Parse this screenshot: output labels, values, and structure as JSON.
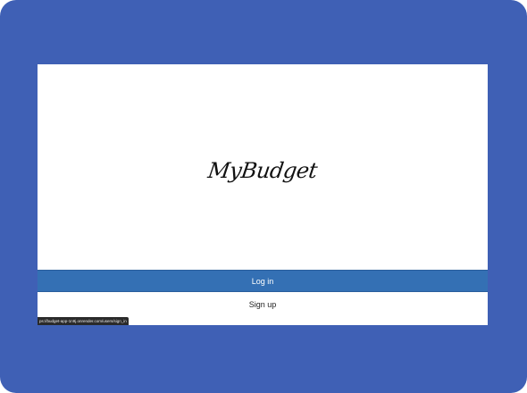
{
  "colors": {
    "frame": "#3f60b5",
    "login_button": "#3470b4",
    "screen_background": "#ffffff"
  },
  "app": {
    "logo_text": "MyBudget"
  },
  "actions": {
    "login_label": "Log in",
    "signup_label": "Sign up"
  },
  "status_bar": {
    "url": "ps://budget-app-1n9j.onrender.com/users/sign_in"
  }
}
